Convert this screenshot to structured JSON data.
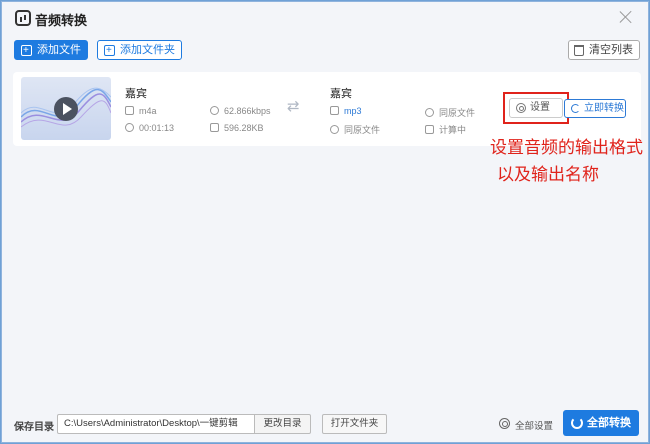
{
  "window": {
    "title": "音频转换"
  },
  "toolbar": {
    "add_file_label": "添加文件",
    "add_folder_label": "添加文件夹",
    "clear_list_label": "清空列表"
  },
  "file_item": {
    "source": {
      "name": "嘉宾",
      "format": "m4a",
      "bitrate": "62.866kbps",
      "duration": "00:01:13",
      "size": "596.28KB"
    },
    "output": {
      "name": "嘉宾",
      "format": "mp3",
      "quality": "同原文件",
      "location": "同原文件",
      "size": "计算中"
    },
    "settings_label": "设置",
    "convert_label": "立即转换"
  },
  "annotation": {
    "line1": "设置音频的输出格式",
    "line2": "以及输出名称"
  },
  "bottombar": {
    "save_dir_label": "保存目录",
    "save_dir_value": "C:\\Users\\Administrator\\Desktop\\一键剪辑",
    "change_dir_label": "更改目录",
    "open_folder_label": "打开文件夹",
    "all_settings_label": "全部设置",
    "convert_all_label": "全部转换"
  },
  "colors": {
    "accent": "#1e7be0",
    "annotation_red": "#e0231b"
  }
}
